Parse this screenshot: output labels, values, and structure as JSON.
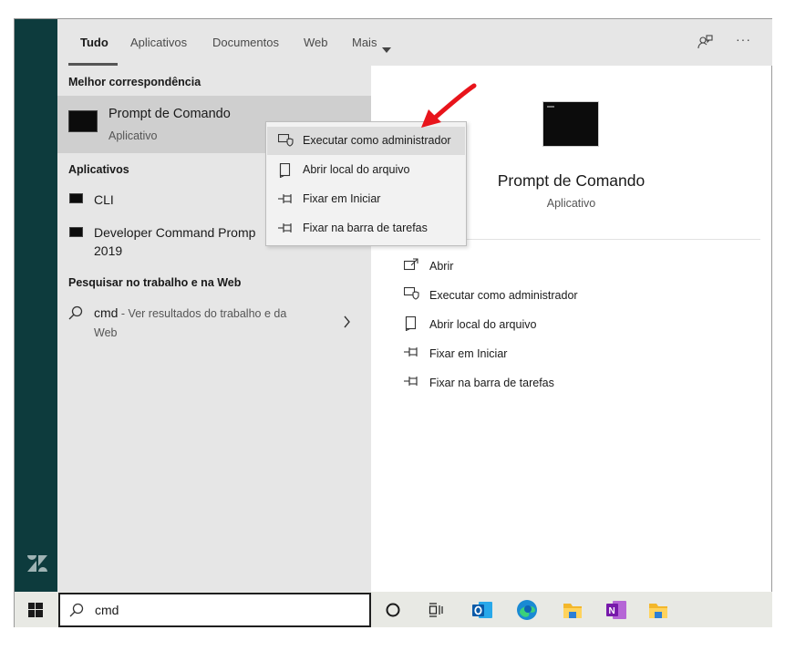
{
  "tabs": [
    "Tudo",
    "Aplicativos",
    "Documentos",
    "Web",
    "Mais"
  ],
  "best_match": {
    "header": "Melhor correspondência",
    "title": "Prompt de Comando",
    "subtitle": "Aplicativo"
  },
  "apps": {
    "header": "Aplicativos",
    "items": [
      "CLI",
      "Developer Command Promp",
      "2019"
    ]
  },
  "web": {
    "header": "Pesquisar no trabalho e na Web",
    "query": "cmd",
    "suffix": " - Ver resultados do trabalho e da",
    "suffix2": "Web"
  },
  "context_menu": [
    "Executar como administrador",
    "Abrir local do arquivo",
    "Fixar em Iniciar",
    "Fixar na barra de tarefas"
  ],
  "preview": {
    "title": "Prompt de Comando",
    "subtitle": "Aplicativo",
    "actions": [
      "Abrir",
      "Executar como administrador",
      "Abrir local do arquivo",
      "Fixar em Iniciar",
      "Fixar na barra de tarefas"
    ]
  },
  "search_box": {
    "value": "cmd"
  },
  "taskbar_icons": [
    "start-icon",
    "cortana-icon",
    "task-view-icon",
    "outlook-icon",
    "edge-icon",
    "file-explorer-icon",
    "onenote-icon",
    "folder-icon"
  ],
  "colors": {
    "sidebar": "#0d3b3d",
    "arrow": "#e8141b",
    "accent": "#0078d4"
  }
}
